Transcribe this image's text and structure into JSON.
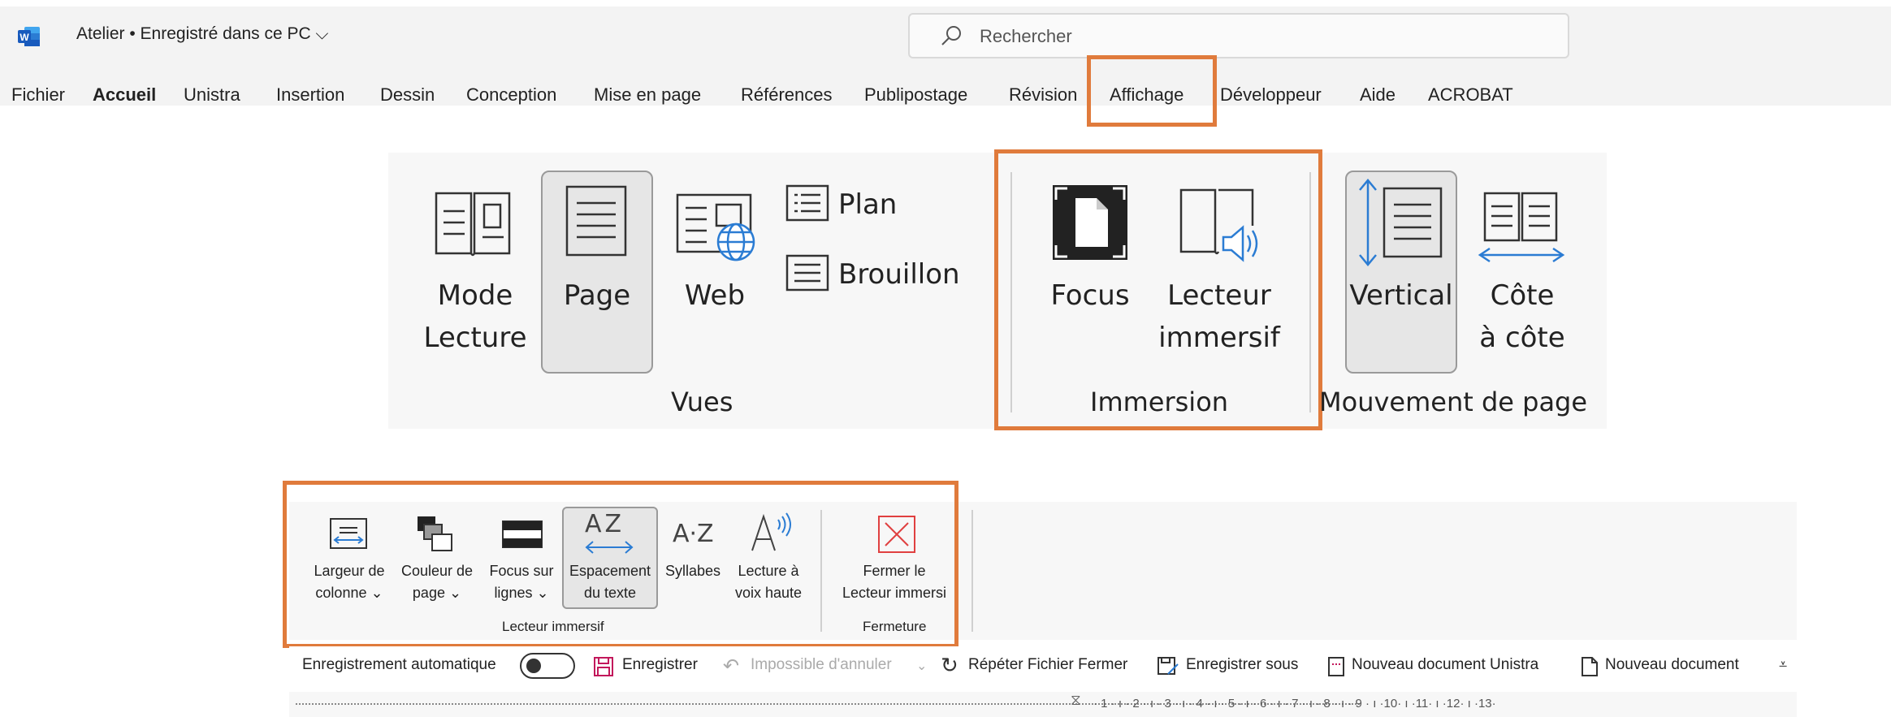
{
  "titlebar": {
    "doc_title": "Atelier • Enregistré dans ce PC ⌵",
    "search_placeholder": "Rechercher"
  },
  "menu_tabs": [
    "Fichier",
    "Accueil",
    "Unistra",
    "Insertion",
    "Dessin",
    "Conception",
    "Mise en page",
    "Références",
    "Publipostage",
    "Révision",
    "Affichage",
    "Développeur",
    "Aide",
    "ACROBAT"
  ],
  "ribbon_views": {
    "mode_lecture": "Mode\nLecture",
    "page": "Page",
    "web": "Web",
    "plan": "Plan",
    "brouillon": "Brouillon",
    "group_vues": "Vues",
    "focus": "Focus",
    "lecteur_immersif": "Lecteur\nimmersif",
    "group_immersion": "Immersion",
    "vertical": "Vertical",
    "cote_a_cote": "Côte\nà côte",
    "group_mouvement": "Mouvement de page"
  },
  "ribbon_immersive": {
    "largeur": "Largeur de\ncolonne ⌄",
    "couleur": "Couleur de\npage ⌄",
    "focus_lignes": "Focus sur\nlignes ⌄",
    "espacement": "Espacement\ndu texte",
    "syllabes": "Syllabes",
    "lecture_voix": "Lecture à\nvoix haute",
    "fermer": "Fermer le\nLecteur immersi",
    "group_lecteur": "Lecteur immersif",
    "group_fermeture": "Fermeture",
    "az_glyph": "AZ",
    "az_small": "A·Z"
  },
  "qat": {
    "autosave": "Enregistrement automatique",
    "save": "Enregistrer",
    "undo": "Impossible d'annuler",
    "repeat": "Répéter Fichier Fermer",
    "save_as": "Enregistrer sous",
    "new_unistra": "Nouveau document Unistra",
    "new_doc": "Nouveau document"
  },
  "ruler_numbers": "· 1 · ı · 2 · ı · 3 · ı · 4 · ı · 5 · ı · 6 · ı · 7 · ı · 8 · ı · 9 · ı ·10· ı ·11· ı ·12· ı ·13·",
  "colors": {
    "highlight": "#e07b3c",
    "accent_blue": "#2b7cd3",
    "word_blue": "#185abd",
    "close_red": "#e04040"
  }
}
